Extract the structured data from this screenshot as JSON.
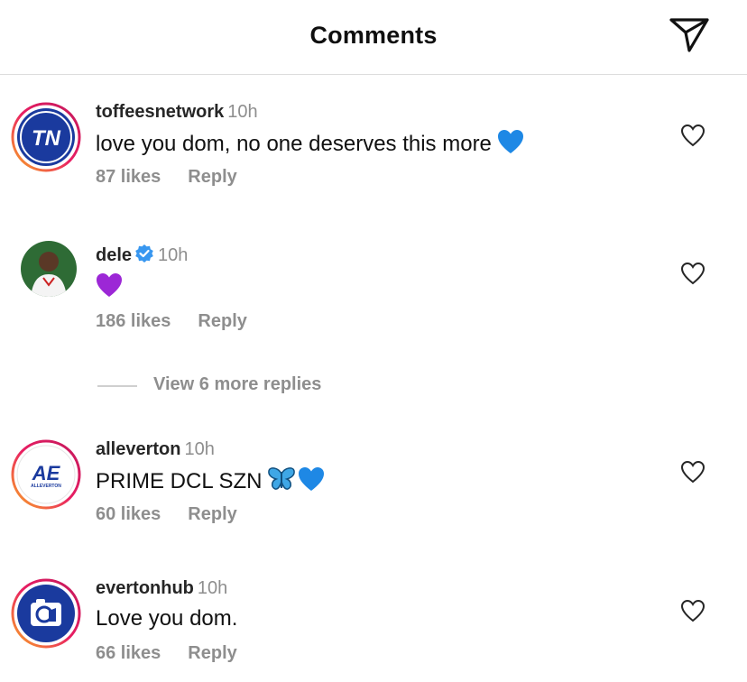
{
  "header": {
    "title": "Comments",
    "send_icon": "paper-plane-icon"
  },
  "comments": [
    {
      "username": "toffeesnetwork",
      "time": "10h",
      "text": "love you dom, no one deserves this more",
      "emoji": "blue-heart",
      "likes": "87 likes",
      "reply": "Reply",
      "avatar_text": "TN",
      "verified": false
    },
    {
      "username": "dele",
      "time": "10h",
      "text": "",
      "emoji": "purple-heart",
      "likes": "186 likes",
      "reply": "Reply",
      "verified": true
    },
    {
      "username": "alleverton",
      "time": "10h",
      "text": "PRIME DCL SZN",
      "emoji": "butterfly-blue-heart",
      "likes": "60 likes",
      "reply": "Reply",
      "avatar_text": "AE",
      "avatar_subtext": "ALLEVERTON",
      "verified": false
    },
    {
      "username": "evertonhub",
      "time": "10h",
      "text": "Love you dom.",
      "emoji": "",
      "likes": "66 likes",
      "reply": "Reply",
      "verified": false
    }
  ],
  "replies_toggle": {
    "label": "View 6 more replies"
  },
  "colors": {
    "story_ring_start": "#f9a825",
    "story_ring_end": "#c2185b",
    "verified": "#3897f0",
    "muted": "#8e8e8e"
  }
}
